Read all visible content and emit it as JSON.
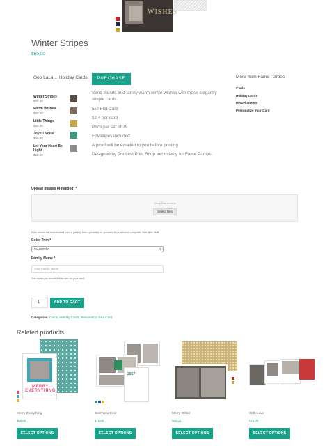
{
  "product": {
    "title": "Winter Stripes",
    "price": "$60.00",
    "hero_text": "WISHES",
    "swatch_colors": [
      "#c0262c",
      "#1f2a44",
      "#caa43b"
    ]
  },
  "sidebar": {
    "title": "Ooo LaLa… Holiday Cards!",
    "items": [
      {
        "name": "Winter Stripes",
        "price": "$60.00",
        "thumb": "#5a4e48"
      },
      {
        "name": "Warm Wishes",
        "price": "$60.00",
        "thumb": "#7d6b60"
      },
      {
        "name": "Little Things",
        "price": "$60.00",
        "thumb": "#c9a349"
      },
      {
        "name": "Joyful Noise",
        "price": "$60.00",
        "thumb": "#3a9a7f"
      },
      {
        "name": "Let Your Heart Be Light",
        "price": "$60.00",
        "thumb": "#8c8c8c"
      }
    ]
  },
  "description": {
    "purchase_label": "PURCHASE",
    "lines": [
      "Send friends and family warm winter wishes with these elegantly simple cards.",
      "5x7 Flat Card",
      "$2.4 per card",
      "Price per set of 25",
      "Envelopes included",
      "A proof will be emailed to you before printing",
      "Designed by Prettiest Print Shop exclusively for Fame Parties."
    ]
  },
  "more": {
    "title": "More from Fame Parties",
    "links": [
      "Cards",
      "Holiday Cards",
      "Miscellaneous",
      "Personalize Your Card"
    ]
  },
  "form": {
    "upload_label": "Upload images (4 needed) *",
    "drop_text": "Drop files here or",
    "select_files": "Select files",
    "upload_note": "Files should be downloaded from a gallery, then uploaded or uploaded from a home computer. Size limit 2MB.",
    "color_label": "Color Trim *",
    "color_value": "MAGENTA",
    "family_label": "Family Name *",
    "family_placeholder": "Your Family Name",
    "family_note": "The name you would like to see on your card.",
    "qty": "1",
    "add_to_cart": "ADD TO CART",
    "categories_label": "Categories:",
    "categories": "Cards, Holiday Cards, Personalize Your Card"
  },
  "related": {
    "title": "Related products",
    "products": [
      {
        "name": "Merry Everything",
        "price": "$60.00",
        "button": "SELECT OPTIONS",
        "art": "MERRY EVERYTHING"
      },
      {
        "name": "Best Year Ever",
        "price": "$75.00",
        "button": "SELECT OPTIONS",
        "art": "2017"
      },
      {
        "name": "Merry Glitter",
        "price": "$60.00",
        "button": "SELECT OPTIONS",
        "art": ""
      },
      {
        "name": "With Love",
        "price": "$75.00",
        "button": "SELECT OPTIONS",
        "art": ""
      }
    ]
  }
}
